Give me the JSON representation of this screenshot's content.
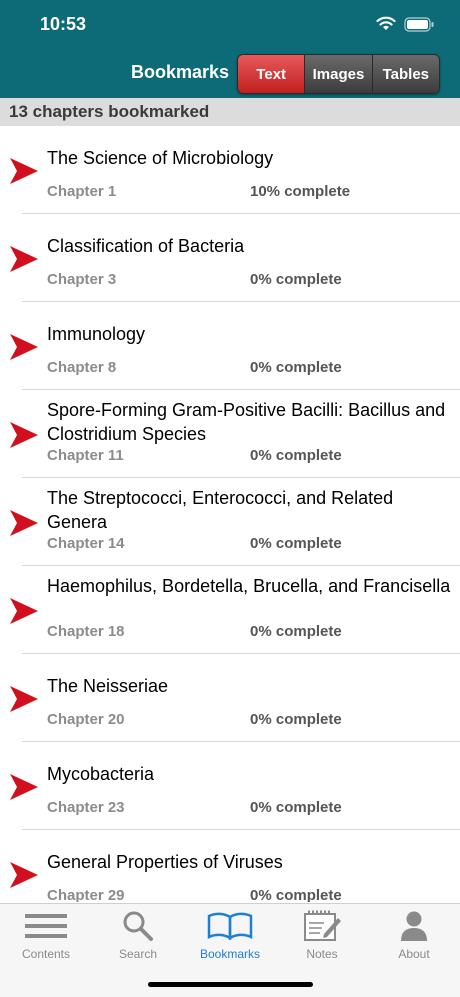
{
  "status": {
    "time": "10:53"
  },
  "nav": {
    "title": "Bookmarks",
    "segments": [
      {
        "label": "Text",
        "active": true
      },
      {
        "label": "Images",
        "active": false
      },
      {
        "label": "Tables",
        "active": false
      }
    ]
  },
  "summary": "13 chapters bookmarked",
  "bookmarks": [
    {
      "title": "The Science of Microbiology",
      "chapter": "Chapter 1",
      "progress": "10% complete"
    },
    {
      "title": "Classification of Bacteria",
      "chapter": "Chapter 3",
      "progress": "0% complete"
    },
    {
      "title": "Immunology",
      "chapter": "Chapter 8",
      "progress": "0% complete"
    },
    {
      "title": "Spore-Forming Gram-Positive Bacilli: Bacillus and Clostridium Species",
      "chapter": "Chapter 11",
      "progress": "0% complete"
    },
    {
      "title": "The Streptococci, Enterococci, and Related Genera",
      "chapter": "Chapter 14",
      "progress": "0% complete"
    },
    {
      "title": "Haemophilus, Bordetella, Brucella, and Francisella",
      "chapter": "Chapter 18",
      "progress": "0% complete"
    },
    {
      "title": "The Neisseriae",
      "chapter": "Chapter 20",
      "progress": "0% complete"
    },
    {
      "title": "Mycobacteria",
      "chapter": "Chapter 23",
      "progress": "0% complete"
    },
    {
      "title": "General Properties of Viruses",
      "chapter": "Chapter 29",
      "progress": "0% complete"
    }
  ],
  "tabs": [
    {
      "label": "Contents",
      "icon": "list-icon"
    },
    {
      "label": "Search",
      "icon": "search-icon"
    },
    {
      "label": "Bookmarks",
      "icon": "book-icon",
      "active": true
    },
    {
      "label": "Notes",
      "icon": "notepad-icon"
    },
    {
      "label": "About",
      "icon": "person-icon"
    }
  ],
  "colors": {
    "header": "#0d6b77",
    "segment_active": "#d12c2c",
    "bookmark_arrow": "#d0101e",
    "tab_active": "#1e7fd3"
  }
}
